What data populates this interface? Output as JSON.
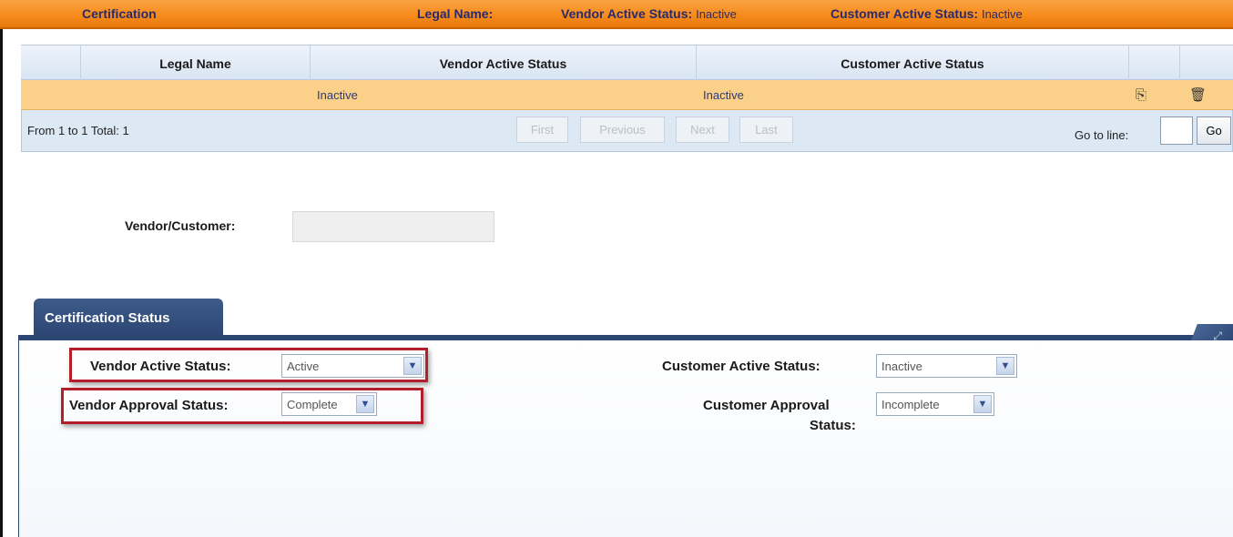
{
  "header": {
    "title": "Certification",
    "legal_name_label": "Legal Name:",
    "legal_name_value": "",
    "vendor_status_label": "Vendor Active Status:",
    "vendor_status_value": "Inactive",
    "customer_status_label": "Customer Active Status:",
    "customer_status_value": "Inactive"
  },
  "grid": {
    "columns": [
      "Legal Name",
      "Vendor Active Status",
      "Customer Active Status"
    ],
    "rows": [
      {
        "legal_name": "",
        "vendor_active_status": "Inactive",
        "customer_active_status": "Inactive"
      }
    ],
    "copy_icon": "copy-icon",
    "delete_icon": "trash-icon"
  },
  "pager": {
    "info": "From 1 to 1 Total: 1",
    "first": "First",
    "previous": "Previous",
    "next": "Next",
    "last": "Last",
    "goto_label": "Go to line:",
    "goto_value": "",
    "go_button": "Go"
  },
  "vendor_customer": {
    "label": "Vendor/Customer:",
    "value": ""
  },
  "tab": {
    "label": "Certification Status"
  },
  "form": {
    "vendor_active_label": "Vendor Active Status:",
    "vendor_active_value": "Active",
    "vendor_approval_label": "Vendor Approval Status:",
    "vendor_approval_value": "Complete",
    "customer_active_label": "Customer Active Status:",
    "customer_active_value": "Inactive",
    "customer_approval_label_1": "Customer Approval",
    "customer_approval_label_2": "Status:",
    "customer_approval_value": "Incomplete"
  },
  "colors": {
    "header_orange": "#f58a1a",
    "row_highlight": "#fbd18a",
    "tab_blue": "#2c4673",
    "highlight_red": "#b21f2a"
  }
}
